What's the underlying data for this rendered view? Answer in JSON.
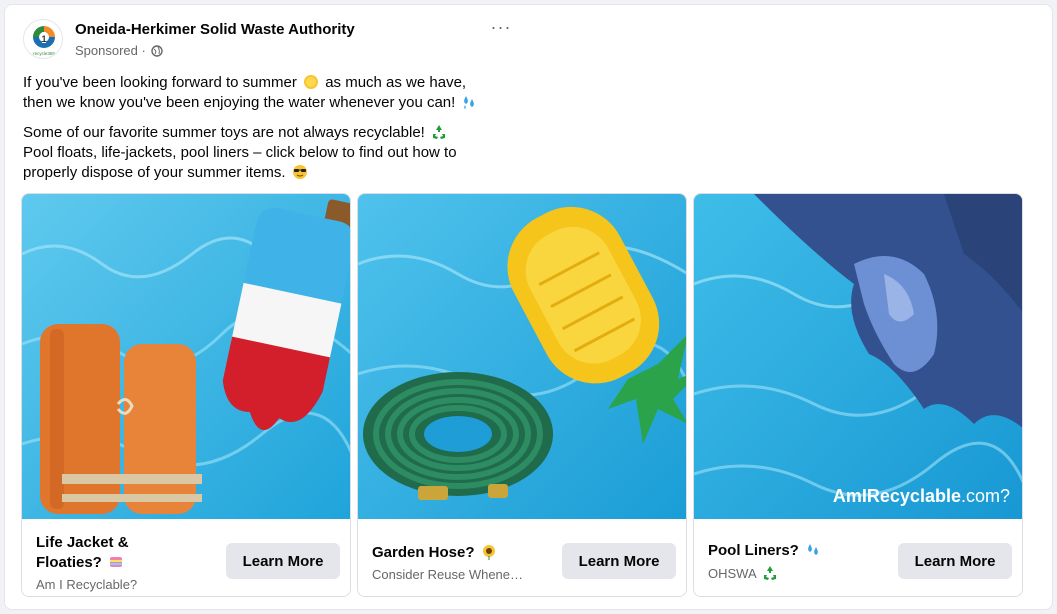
{
  "post": {
    "page_name": "Oneida-Herkimer Solid Waste Authority",
    "sponsored_label": "Sponsored",
    "separator": "·",
    "more_label": "···",
    "avatar_text": "recycle365",
    "paragraphs": [
      {
        "before": "If you've been looking forward to summer",
        "after": "as much as we have,"
      },
      {
        "line2": "then we know you've been enjoying the water whenever you can!"
      },
      {
        "line1": "Some of our favorite summer toys are not always recyclable!"
      },
      {
        "line2": "Pool floats, life-jackets, pool liners – click below to find out how to"
      },
      {
        "line3": "properly dispose of your summer items."
      }
    ]
  },
  "cards": [
    {
      "title_line1": "Life Jacket &",
      "title_line2": "Floaties?",
      "subtitle": "Am I Recyclable?",
      "button": "Learn More"
    },
    {
      "title_line1": "Garden Hose?",
      "subtitle": "Consider Reuse Whene…",
      "button": "Learn More"
    },
    {
      "title_line1": "Pool Liners?",
      "subtitle": "OHSWA",
      "button": "Learn More",
      "watermark_bold": "AmIRecyclable",
      "watermark_light": ".com?"
    }
  ],
  "colors": {
    "water": "#2bb3e4",
    "water_light": "#7fd9f5",
    "brand_green": "#2e8b3a"
  }
}
